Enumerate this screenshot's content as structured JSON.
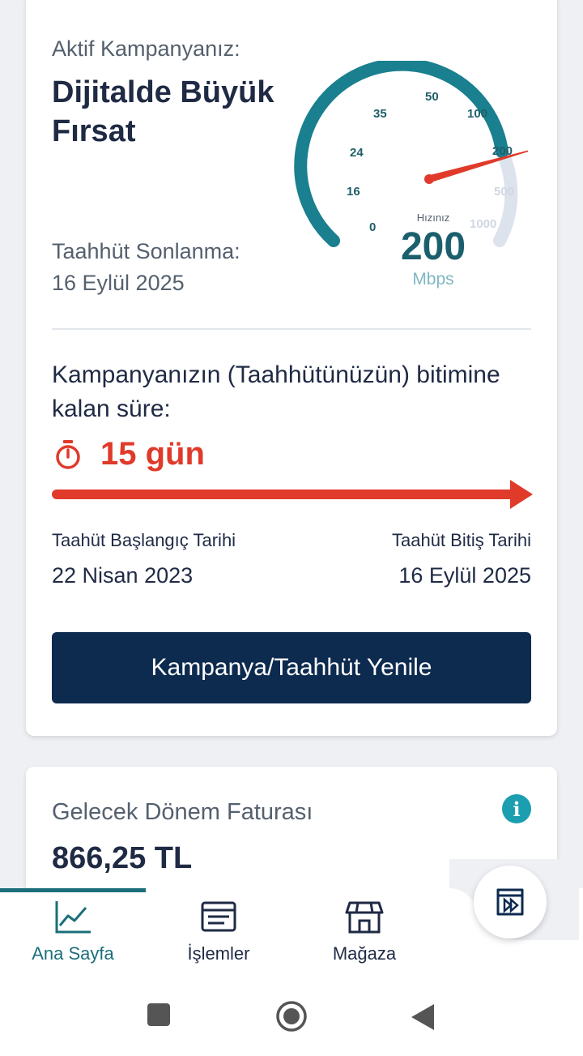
{
  "campaign": {
    "active_label": "Aktif Kampanyanız:",
    "name": "Dijitalde Büyük Fırsat",
    "commit_end_label": "Taahhüt Sonlanma:",
    "commit_end_date": "16 Eylül 2025",
    "speed": {
      "ticks": [
        "0",
        "16",
        "24",
        "35",
        "50",
        "100",
        "200",
        "500",
        "1000"
      ],
      "label": "Hızınız",
      "value": "200",
      "unit": "Mbps"
    },
    "remaining_question": "Kampanyanızın (Taahhütünüzün) bitimine kalan süre:",
    "remaining_value": "15 gün",
    "start_label": "Taahüt Başlangıç Tarihi",
    "start_date": "22 Nisan 2023",
    "end_label": "Taahüt Bitiş Tarihi",
    "end_date": "16 Eylül 2025",
    "renew_button": "Kampanya/Taahhüt Yenile"
  },
  "bill": {
    "title": "Gelecek Dönem Faturası",
    "amount": "866,25 TL"
  },
  "nav": {
    "items": [
      {
        "label": "Ana Sayfa",
        "icon": "chart-icon",
        "active": true
      },
      {
        "label": "İşlemler",
        "icon": "list-icon"
      },
      {
        "label": "Mağaza",
        "icon": "store-icon"
      }
    ],
    "fab_icon": "fast-forward-icon"
  },
  "colors": {
    "accent_teal": "#1b6f7a",
    "alert_red": "#e03a2b",
    "button_navy": "#0d2a4f"
  }
}
